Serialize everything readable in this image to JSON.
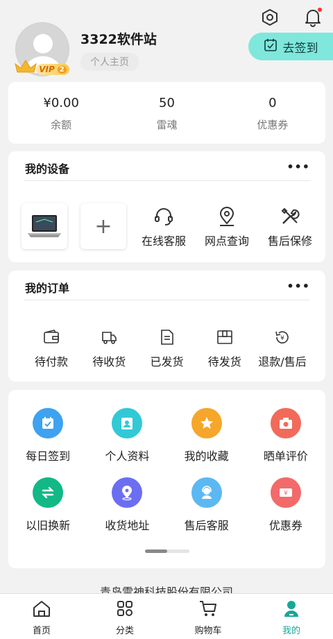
{
  "header": {
    "settings_icon": "settings-hexagon-icon",
    "bell_icon": "bell-icon"
  },
  "profile": {
    "username": "3322软件站",
    "homepage_link": "个人主页",
    "vip_label": "VIP",
    "vip_level": "2",
    "signin_label": "去签到"
  },
  "stats": [
    {
      "value": "¥0.00",
      "label": "余额"
    },
    {
      "value": "50",
      "label": "雷魂"
    },
    {
      "value": "0",
      "label": "优惠券"
    }
  ],
  "devices": {
    "title": "我的设备",
    "services": [
      {
        "label": "在线客服",
        "icon": "headset-icon"
      },
      {
        "label": "网点查询",
        "icon": "location-pin-icon"
      },
      {
        "label": "售后保修",
        "icon": "tools-icon"
      }
    ]
  },
  "orders": {
    "title": "我的订单",
    "items": [
      {
        "label": "待付款",
        "icon": "wallet-icon"
      },
      {
        "label": "待收货",
        "icon": "truck-icon"
      },
      {
        "label": "已发货",
        "icon": "document-icon"
      },
      {
        "label": "待发货",
        "icon": "box-icon"
      },
      {
        "label": "退款/售后",
        "icon": "refund-icon"
      }
    ]
  },
  "tools": [
    {
      "label": "每日签到",
      "icon": "calendar-check-icon",
      "color": "#3ea2f0"
    },
    {
      "label": "个人资料",
      "icon": "id-card-icon",
      "color": "#31c9d6"
    },
    {
      "label": "我的收藏",
      "icon": "star-icon",
      "color": "#f6a62a"
    },
    {
      "label": "晒单评价",
      "icon": "camera-icon",
      "color": "#f26a5a"
    },
    {
      "label": "以旧换新",
      "icon": "exchange-icon",
      "color": "#12b886"
    },
    {
      "label": "收货地址",
      "icon": "map-pin-icon",
      "color": "#6c6ef2"
    },
    {
      "label": "售后客服",
      "icon": "customer-service-icon",
      "color": "#5cb8f2"
    },
    {
      "label": "优惠券",
      "icon": "coupon-icon",
      "color": "#f26a6a"
    }
  ],
  "footer": {
    "company": "青岛雷神科技股份有限公司"
  },
  "tabbar": [
    {
      "label": "首页",
      "icon": "home-icon"
    },
    {
      "label": "分类",
      "icon": "category-grid-icon"
    },
    {
      "label": "购物车",
      "icon": "cart-icon"
    },
    {
      "label": "我的",
      "icon": "user-icon"
    }
  ],
  "colors": {
    "accent": "#17a79a",
    "signin_bg": "#7fe7dc"
  }
}
